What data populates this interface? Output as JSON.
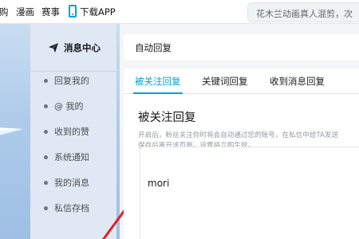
{
  "topnav": {
    "items": [
      "购",
      "漫画",
      "赛事",
      "下载APP"
    ],
    "search_text": "花木兰动画真人混剪，次"
  },
  "sidebar": {
    "header": "消息中心",
    "items": [
      {
        "label": "回复我的"
      },
      {
        "label": "@ 我的"
      },
      {
        "label": "收到的赞"
      },
      {
        "label": "系统通知"
      },
      {
        "label": "我的消息"
      },
      {
        "label": "私信存档"
      }
    ]
  },
  "auto_reply": {
    "header": "自动回复",
    "tabs": [
      {
        "label": "被关注回复",
        "active": true
      },
      {
        "label": "关键词回复",
        "active": false
      },
      {
        "label": "收到消息回复",
        "active": false
      }
    ],
    "section_title": "被关注回复",
    "description_lines": [
      "开启后，粉丝关注你时将会自动通过您的账号，在私信中给TA发送",
      "保存后离开该页面，设置将立即生效。"
    ],
    "reply_value": "mori"
  },
  "colors": {
    "accent": "#00a1d6",
    "annotation_arrow": "#e02020"
  }
}
